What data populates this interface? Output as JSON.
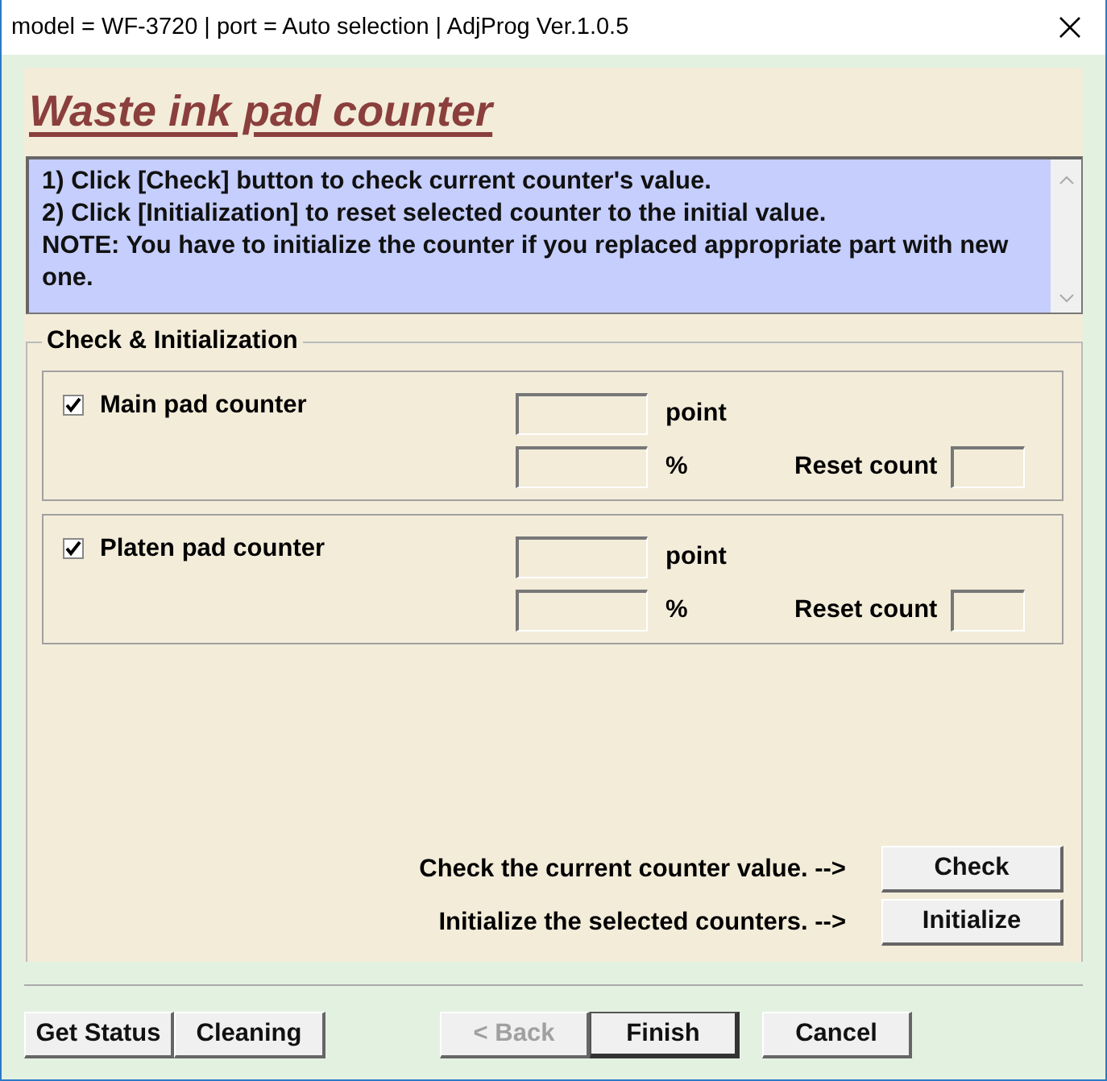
{
  "window": {
    "title": "model = WF-3720 | port = Auto selection | AdjProg Ver.1.0.5"
  },
  "heading": "Waste ink pad counter",
  "instructions": [
    "1) Click [Check] button to check current counter's value.",
    "2) Click [Initialization] to reset selected counter to the initial value.",
    "NOTE: You have to initialize the counter if you replaced appropriate part with new one."
  ],
  "group": {
    "title": "Check & Initialization",
    "counters": [
      {
        "label": "Main pad counter",
        "checked": true,
        "point_unit": "point",
        "percent_unit": "%",
        "reset_label": "Reset count"
      },
      {
        "label": "Platen pad counter",
        "checked": true,
        "point_unit": "point",
        "percent_unit": "%",
        "reset_label": "Reset count"
      }
    ]
  },
  "actions": [
    {
      "text": "Check the current counter value. -->",
      "button": "Check"
    },
    {
      "text": "Initialize the selected counters. -->",
      "button": "Initialize"
    }
  ],
  "buttons": [
    {
      "label": "Get Status",
      "disabled": false,
      "default": false
    },
    {
      "label": "Cleaning",
      "disabled": false,
      "default": false
    },
    {
      "label": "< Back",
      "disabled": true,
      "default": false
    },
    {
      "label": "Finish",
      "disabled": false,
      "default": true
    },
    {
      "label": "Cancel",
      "disabled": false,
      "default": false
    }
  ]
}
